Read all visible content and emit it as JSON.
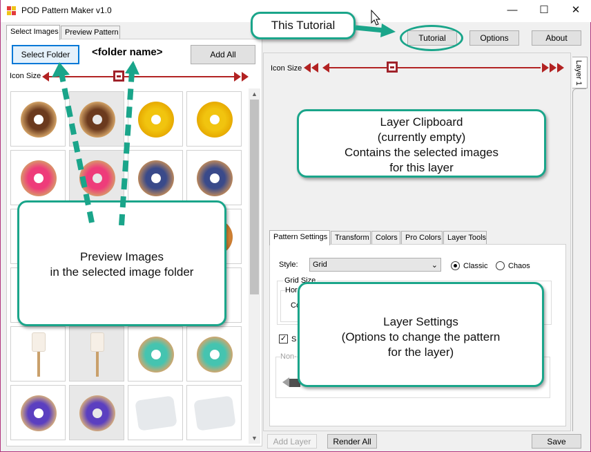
{
  "window": {
    "title": "POD Pattern Maker v1.0",
    "controls": {
      "minimize": "—",
      "maximize": "☐",
      "close": "✕"
    }
  },
  "left_tabs": [
    "Select Images",
    "Preview Pattern"
  ],
  "left_toolbar": {
    "select_folder": "Select Folder",
    "folder_name": "<folder name>",
    "add_all": "Add All",
    "icon_size_label": "Icon Size"
  },
  "top_buttons": {
    "tutorial": "Tutorial",
    "options": "Options",
    "about": "About"
  },
  "right_panel": {
    "icon_size_label": "Icon Size",
    "layer_tab": "Layer 1"
  },
  "settings_tabs": [
    "Pattern Settings",
    "Transform",
    "Colors",
    "Pro Colors",
    "Layer Tools"
  ],
  "pattern_settings": {
    "style_label": "Style:",
    "style_value": "Grid",
    "radio_classic": "Classic",
    "radio_chaos": "Chaos",
    "grid_size_label": "Grid Size",
    "horizontal_label": "Hor",
    "count_label": "Co",
    "check_label": "S",
    "check_mark": "✓",
    "nonuniform_label": "Non-"
  },
  "bottom_buttons": {
    "add_layer": "Add Layer",
    "render_all": "Render All",
    "save": "Save"
  },
  "callouts": {
    "tutorial": "This Tutorial",
    "clipboard": [
      "Layer Clipboard",
      "(currently empty)",
      "Contains the selected images",
      "for this layer"
    ],
    "preview": [
      "Preview Images",
      "in the selected image folder"
    ],
    "settings": [
      "Layer Settings",
      "(Options to change the pattern",
      "for the layer)"
    ]
  },
  "thumbnails": [
    "chocolate-donut",
    "chocolate-donut",
    "yellow-donut",
    "yellow-donut",
    "pink-donut",
    "pink-donut",
    "galaxy-donut",
    "galaxy-donut",
    "",
    "",
    "",
    "orange-donut",
    "",
    "",
    "",
    "",
    "popsicle",
    "popsicle",
    "teal-donut",
    "teal-donut",
    "purple-donut",
    "purple-donut",
    "foil-wrapper",
    "foil-wrapper"
  ],
  "colors": {
    "callout_border": "#1aa58a",
    "slider": "#b22222",
    "focus": "#0078d7"
  }
}
